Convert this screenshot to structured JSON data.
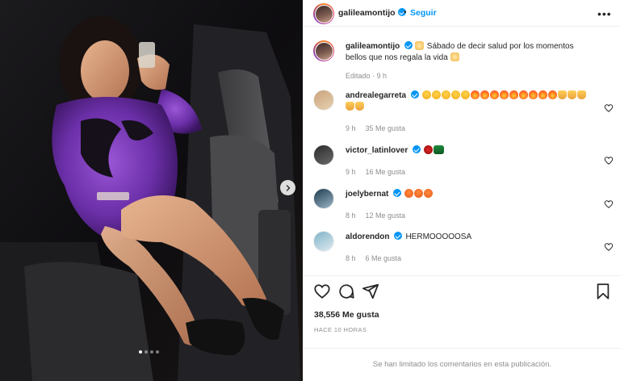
{
  "media": {
    "carousel_dots": 4,
    "active_dot": 0,
    "next_icon": "chevron-right-icon"
  },
  "header": {
    "username": "galileamontijo",
    "separator": "•",
    "follow_label": "Seguir",
    "more_icon": "more-horizontal-icon",
    "more_label": "•••"
  },
  "caption": {
    "username": "galileamontijo",
    "text": "Sábado de decir salud por los momentos bellos que nos regala la vida",
    "meta": "Editado · 9 h"
  },
  "comments": [
    {
      "username": "andrealegarreta",
      "text": "",
      "emojis": [
        "face",
        "face",
        "face",
        "face",
        "face",
        "fire",
        "fire",
        "fire",
        "fire",
        "fire",
        "fire",
        "fire",
        "fire",
        "fire",
        "pray",
        "pray",
        "pray",
        "pray",
        "pray"
      ],
      "time": "9 h",
      "likes": "35 Me gusta"
    },
    {
      "username": "victor_latinlover",
      "text": "",
      "emojis": [
        "rose",
        "car"
      ],
      "time": "9 h",
      "likes": "16 Me gusta"
    },
    {
      "username": "joelybernat",
      "text": "",
      "emojis": [
        "love",
        "love",
        "love"
      ],
      "time": "8 h",
      "likes": "12 Me gusta"
    },
    {
      "username": "aldorendon",
      "text": "HERMOOOOOSA",
      "emojis": [],
      "time": "8 h",
      "likes": "6 Me gusta"
    }
  ],
  "actions": {
    "like_icon": "heart-icon",
    "comment_icon": "comment-icon",
    "share_icon": "share-icon",
    "save_icon": "bookmark-icon"
  },
  "likes_count": "38,556 Me gusta",
  "posted": "HACE 10 HORAS",
  "comments_limited": "Se han limitado los comentarios en esta publicación.",
  "colors": {
    "accent": "#0095f6",
    "muted": "#8e8e8e",
    "text": "#262626",
    "dress": "#6b2fa8"
  }
}
